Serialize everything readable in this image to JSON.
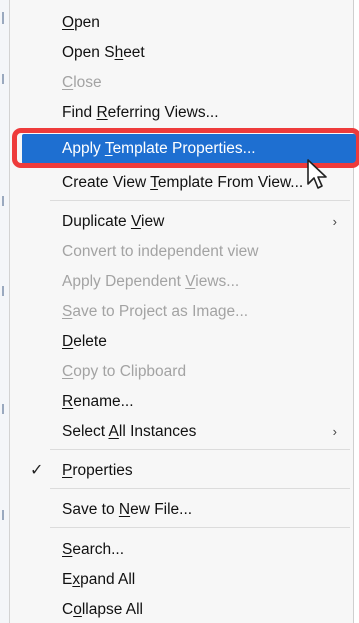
{
  "menu": {
    "items": [
      {
        "label": "Open",
        "accel": "O"
      },
      {
        "label": "Open Sheet",
        "accel": "h"
      },
      {
        "label": "Close",
        "accel": "C"
      },
      {
        "label": "Find Referring Views...",
        "accel": "R"
      },
      {
        "label": "Apply Template Properties...",
        "accel": "T"
      },
      {
        "label": "Create View Template From View...",
        "accel": "T"
      },
      {
        "label": "Duplicate View",
        "accel": "V"
      },
      {
        "label": "Convert to independent view",
        "accel": ""
      },
      {
        "label": "Apply Dependent Views...",
        "accel": "V"
      },
      {
        "label": "Save to Project as Image...",
        "accel": "S"
      },
      {
        "label": "Delete",
        "accel": "D"
      },
      {
        "label": "Copy to Clipboard",
        "accel": "C"
      },
      {
        "label": "Rename...",
        "accel": "R"
      },
      {
        "label": "Select All Instances",
        "accel": "A"
      },
      {
        "label": "Properties",
        "accel": "P"
      },
      {
        "label": "Save to New File...",
        "accel": "N"
      },
      {
        "label": "Search...",
        "accel": "S"
      },
      {
        "label": "Expand All",
        "accel": "x"
      },
      {
        "label": "Collapse All",
        "accel": "o"
      }
    ],
    "submenu_glyph": "›",
    "check_glyph": "✓"
  },
  "colors": {
    "highlight": "#1e6fd1",
    "annotation_border": "#ee3b3b",
    "disabled_text": "#a3a3a3"
  }
}
